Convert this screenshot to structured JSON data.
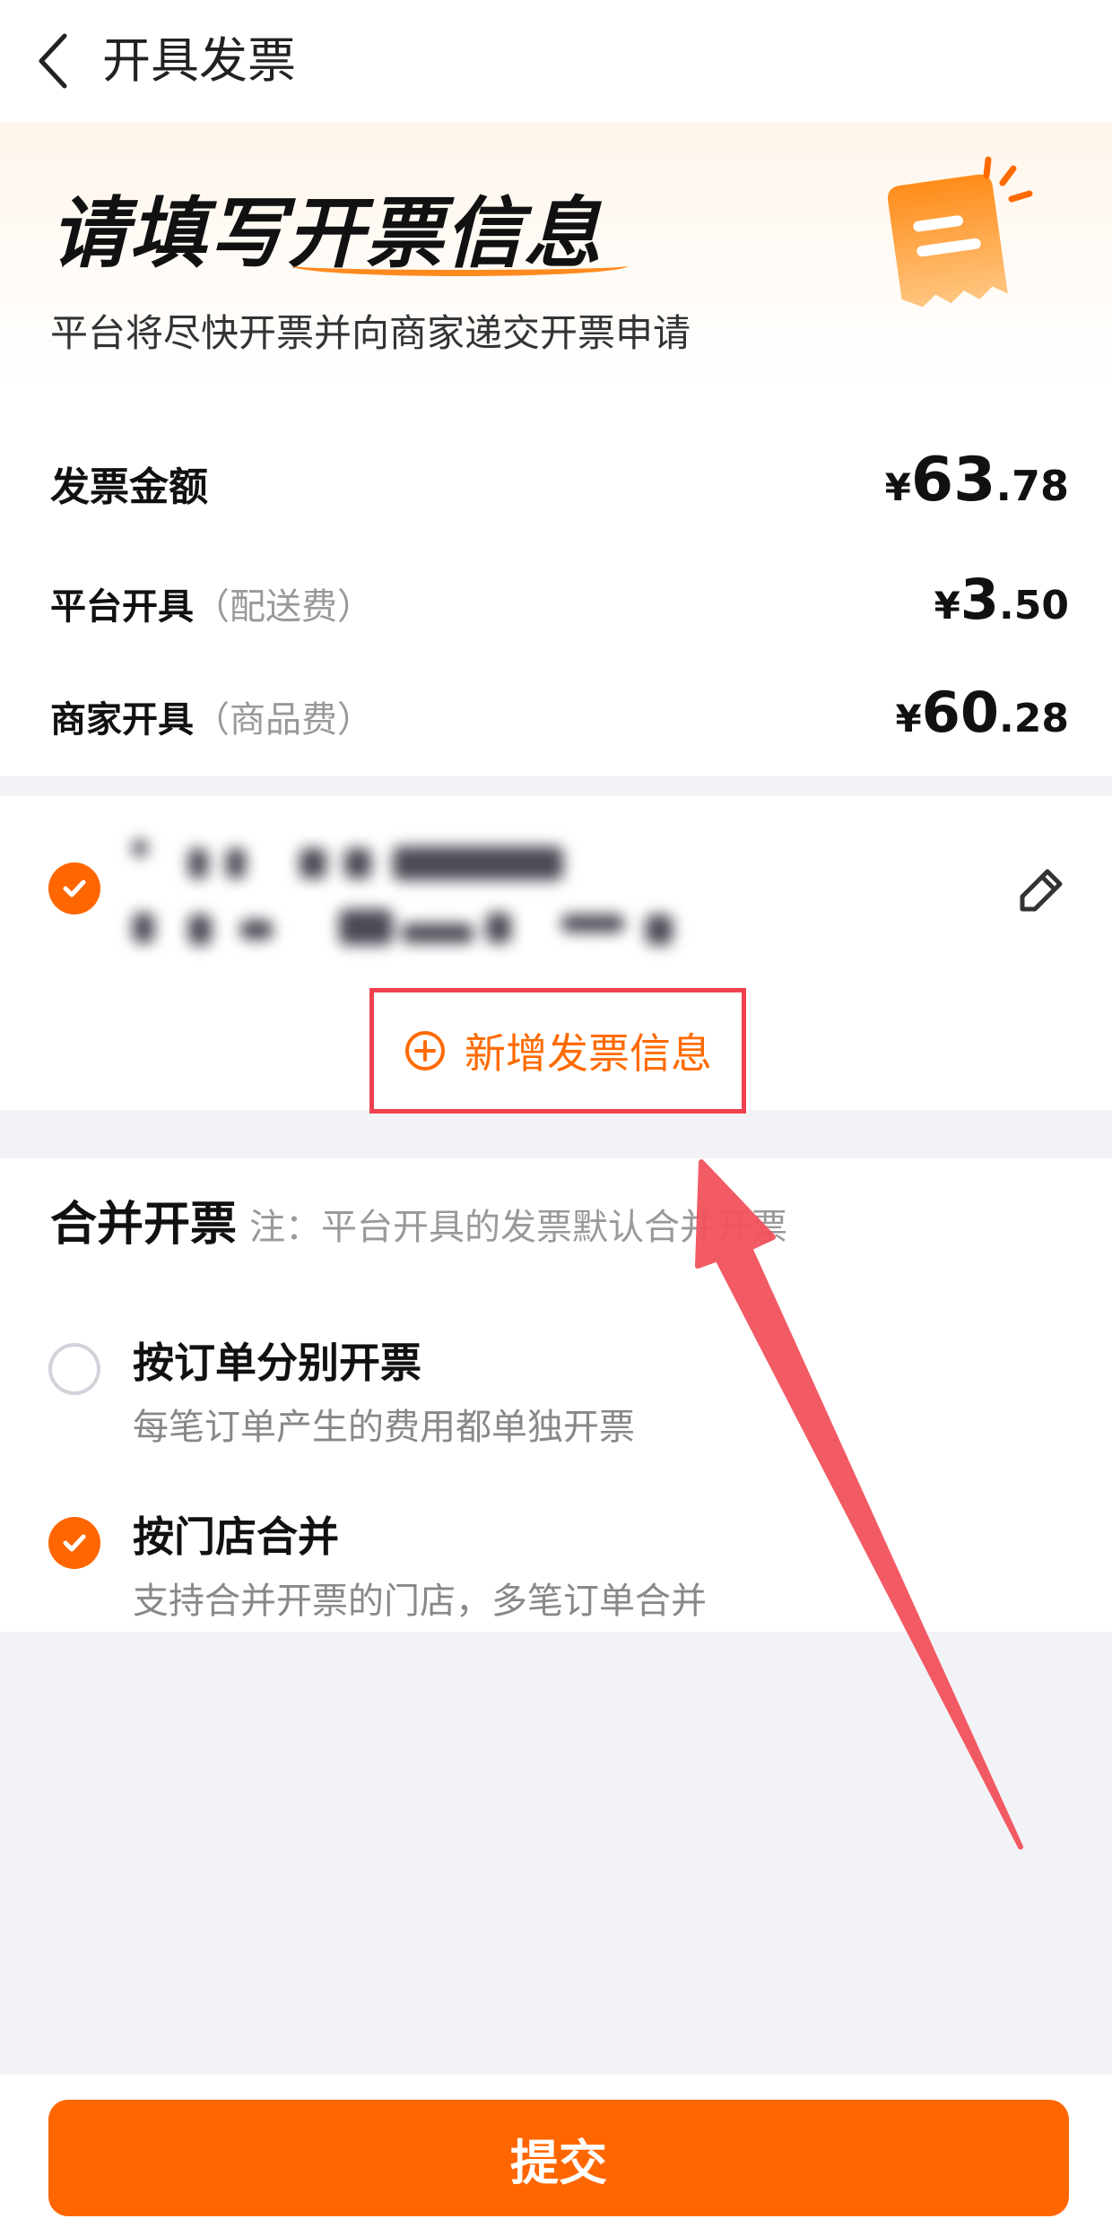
{
  "nav": {
    "title": "开具发票",
    "back_icon": "chevron-left-icon"
  },
  "hero": {
    "title_part1": "请填写",
    "title_part2": "开票信息",
    "subtitle": "平台将尽快开票并向商家递交开票申请",
    "icon": "invoice-icon"
  },
  "amounts": {
    "total": {
      "label": "发票金额",
      "yen": "¥",
      "int": "63",
      "dec": ".78"
    },
    "platform": {
      "label": "平台开具",
      "note": "（配送费）",
      "yen": "¥",
      "int": "3",
      "dec": ".50"
    },
    "merchant": {
      "label": "商家开具",
      "note": "（商品费）",
      "yen": "¥",
      "int": "60",
      "dec": ".28"
    }
  },
  "invoice_info": {
    "selected": true,
    "edit_icon": "edit-pencil-icon",
    "add_label": "新增发票信息",
    "add_icon": "plus-circle-icon"
  },
  "merge": {
    "title": "合并开票",
    "note": "注：平台开具的发票默认合并开票",
    "options": [
      {
        "title": "按订单分别开票",
        "desc": "每笔订单产生的费用都单独开票",
        "selected": false
      },
      {
        "title": "按门店合并",
        "desc": "支持合并开票的门店，多笔订单合并",
        "selected": true
      }
    ]
  },
  "footer": {
    "submit_label": "提交"
  },
  "colors": {
    "accent": "#ff6600",
    "highlight_box": "#f0414e",
    "annotation_arrow": "#f2525c"
  }
}
